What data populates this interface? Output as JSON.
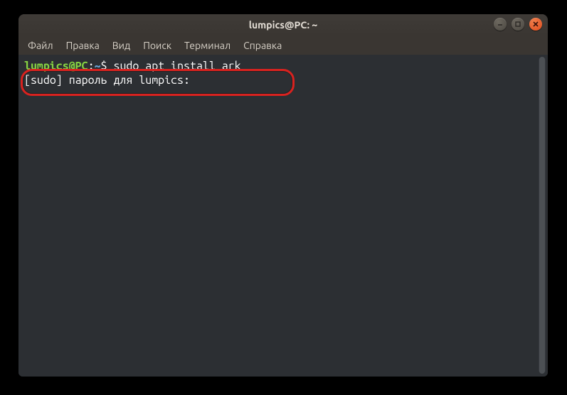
{
  "window": {
    "title": "lumpics@PC: ~"
  },
  "menubar": {
    "items": [
      "Файл",
      "Правка",
      "Вид",
      "Поиск",
      "Терминал",
      "Справка"
    ]
  },
  "prompt": {
    "user_host": "lumpics@PC",
    "sep1": ":",
    "path": "~",
    "dollar": "$"
  },
  "terminal": {
    "command": "sudo apt install ark",
    "output_line": "[sudo] пароль для lumpics:"
  },
  "icons": {
    "minimize": "minimize-icon",
    "maximize": "maximize-icon",
    "close": "close-icon"
  }
}
